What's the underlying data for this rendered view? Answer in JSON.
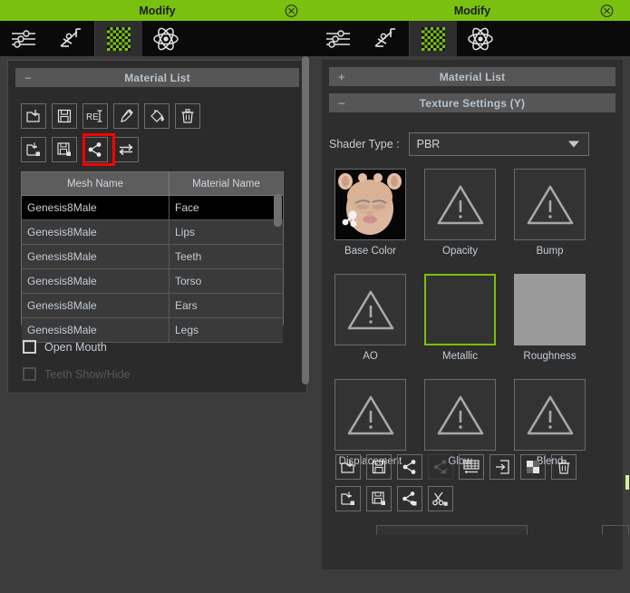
{
  "window": {
    "title": "Modify",
    "close_icon": "close-circle-icon",
    "accent_color": "#7ac00e",
    "panel_bg": "#3c3c3c"
  },
  "tabs": [
    {
      "id": "sliders",
      "icon": "sliders-icon",
      "active": false
    },
    {
      "id": "pose",
      "icon": "pose-figure-icon",
      "active": false
    },
    {
      "id": "material",
      "icon": "checker-material-icon",
      "active": true
    },
    {
      "id": "physics",
      "icon": "atom-icon",
      "active": false
    }
  ],
  "left_panel": {
    "material_list": {
      "label": "Material List",
      "collapse_sign": "−",
      "expanded": true
    },
    "toolbar_row1": [
      {
        "name": "load-material-icon",
        "label": "Load Material",
        "disabled": false
      },
      {
        "name": "save-material-icon",
        "label": "Save Material",
        "disabled": false
      },
      {
        "name": "reset-material-icon",
        "label": "RE",
        "disabled": false
      },
      {
        "name": "eyedropper-icon",
        "label": "Pick Color",
        "disabled": false
      },
      {
        "name": "paint-bucket-icon",
        "label": "Fill Color",
        "disabled": false
      },
      {
        "name": "trash-icon",
        "label": "Delete",
        "disabled": false
      }
    ],
    "toolbar_row2": [
      {
        "name": "load-material-plus-icon",
        "label": "Load Material Plus",
        "disabled": false
      },
      {
        "name": "save-material-plus-icon",
        "label": "Save Material Plus",
        "disabled": false
      },
      {
        "name": "share-node-icon",
        "label": "Share Node",
        "disabled": false,
        "highlighted": true
      },
      {
        "name": "swap-arrows-icon",
        "label": "Swap",
        "disabled": false
      }
    ],
    "table": {
      "columns": [
        "Mesh Name",
        "Material Name"
      ],
      "rows": [
        {
          "mesh": "Genesis8Male",
          "material": "Face",
          "selected": true
        },
        {
          "mesh": "Genesis8Male",
          "material": "Lips",
          "selected": false
        },
        {
          "mesh": "Genesis8Male",
          "material": "Teeth",
          "selected": false
        },
        {
          "mesh": "Genesis8Male",
          "material": "Torso",
          "selected": false
        },
        {
          "mesh": "Genesis8Male",
          "material": "Ears",
          "selected": false
        },
        {
          "mesh": "Genesis8Male",
          "material": "Legs",
          "selected": false
        }
      ]
    },
    "checkboxes": [
      {
        "label": "Open Mouth",
        "checked": false,
        "disabled": false
      },
      {
        "label": "Teeth Show/Hide",
        "checked": false,
        "disabled": true
      }
    ]
  },
  "right_panel": {
    "material_list": {
      "label": "Material List",
      "collapse_sign": "+",
      "expanded": false
    },
    "texture_settings": {
      "label": "Texture Settings  (Y)",
      "collapse_sign": "−",
      "expanded": true
    },
    "shader": {
      "label": "Shader Type :",
      "value": "PBR",
      "arrow_icon": "chevron-down-icon"
    },
    "textures": [
      {
        "label": "Base Color",
        "state": "image",
        "selected": false
      },
      {
        "label": "Opacity",
        "state": "empty",
        "selected": false
      },
      {
        "label": "Bump",
        "state": "empty",
        "selected": false
      },
      {
        "label": "AO",
        "state": "empty",
        "selected": false
      },
      {
        "label": "Metallic",
        "state": "blank",
        "selected": true
      },
      {
        "label": "Roughness",
        "state": "grey",
        "selected": false
      },
      {
        "label": "Displacement",
        "state": "empty",
        "selected": false
      },
      {
        "label": "Glow",
        "state": "empty",
        "selected": false
      },
      {
        "label": "Blend",
        "state": "empty",
        "selected": false
      }
    ],
    "toolbar_row1": [
      {
        "name": "load-texture-icon",
        "label": "Load Texture",
        "disabled": false
      },
      {
        "name": "save-texture-icon",
        "label": "Save Texture",
        "disabled": false
      },
      {
        "name": "share-node-icon",
        "label": "Share Node",
        "disabled": false,
        "highlighted": true
      },
      {
        "name": "share-node-off-icon",
        "label": "Unshare Node",
        "disabled": true
      },
      {
        "name": "uv-grid-icon",
        "label": "UV Grid",
        "disabled": false
      },
      {
        "name": "import-image-icon",
        "label": "Import Image",
        "disabled": false
      },
      {
        "name": "checker-swatch-icon",
        "label": "Checker",
        "disabled": false
      },
      {
        "name": "trash-icon",
        "label": "Delete",
        "disabled": false
      }
    ],
    "toolbar_row2": [
      {
        "name": "load-texture-plus-icon",
        "label": "Load Texture Plus",
        "disabled": false
      },
      {
        "name": "save-texture-plus-icon",
        "label": "Save Texture Plus",
        "disabled": false
      },
      {
        "name": "share-node-plus-icon",
        "label": "Share Node Plus",
        "disabled": false,
        "highlighted": true
      },
      {
        "name": "cut-node-icon",
        "label": "Cut Node",
        "disabled": false
      }
    ]
  }
}
